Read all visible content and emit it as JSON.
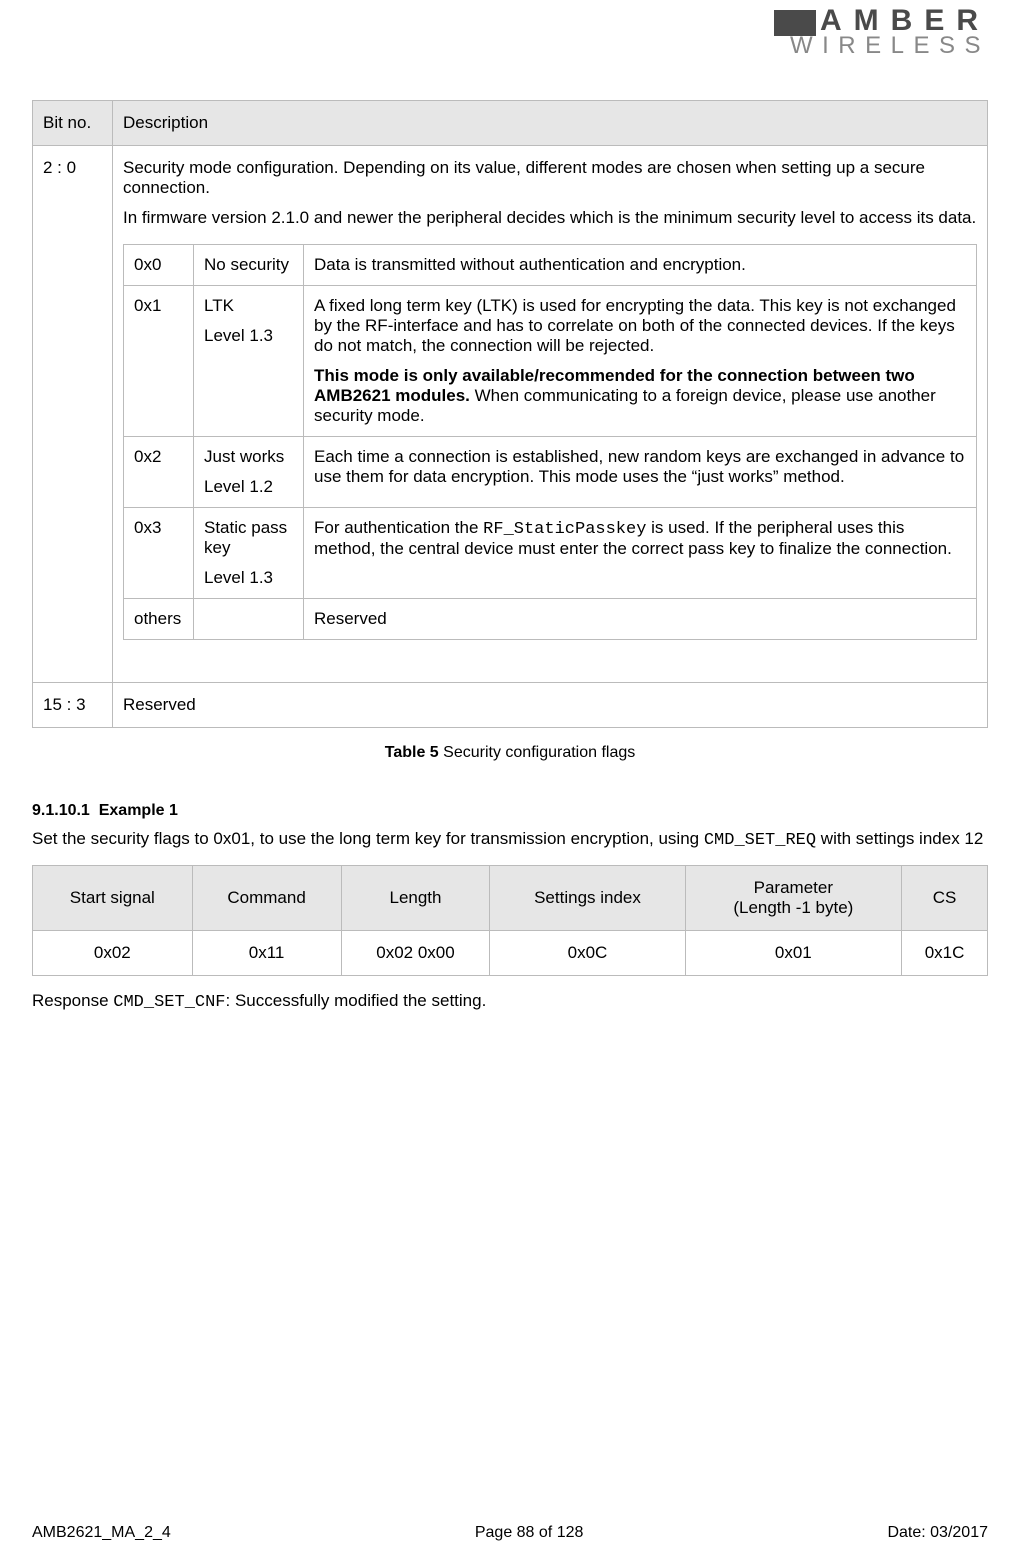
{
  "logo": {
    "top": "AMBER",
    "bottom": "WIRELESS"
  },
  "outerHeaders": {
    "bitno": "Bit no.",
    "description": "Description"
  },
  "row20": {
    "bits": "2 : 0",
    "p1": "Security mode configuration. Depending on its value, different modes are chosen when setting up a secure connection.",
    "p2": "In firmware version 2.1.0 and newer the peripheral decides which is the minimum security level to access its data."
  },
  "inner": [
    {
      "code": "0x0",
      "label_lines": [
        "No security"
      ],
      "desc_parts": [
        {
          "text": "Data is transmitted without authentication and encryption.",
          "bold": false
        }
      ]
    },
    {
      "code": "0x1",
      "label_lines": [
        "LTK",
        "Level 1.3"
      ],
      "desc_parts": [
        {
          "text": "A fixed long term key (LTK) is used for encrypting the data. This key is not exchanged by the RF-interface and has to correlate on both of the connected devices. If the keys do not match, the connection will be rejected.",
          "bold": false
        },
        {
          "text_bold": "This mode is only available/recommended for the connection between two AMB2621 modules. ",
          "text_tail": "When communicating to a foreign device, please use another security mode."
        }
      ]
    },
    {
      "code": "0x2",
      "label_lines": [
        "Just works",
        "Level 1.2"
      ],
      "desc_parts": [
        {
          "text": "Each time a connection is established, new random keys are exchanged in advance to use them for data encryption. This mode uses the “just works” method.",
          "bold": false
        }
      ]
    },
    {
      "code": "0x3",
      "label_lines": [
        "Static pass key",
        "Level 1.3"
      ],
      "desc_parts": [
        {
          "text_pre": "For authentication the ",
          "code": "RF_StaticPasskey",
          "text_post": " is used. If the peripheral uses this method, the central device must enter the correct pass key to finalize the connection."
        }
      ]
    },
    {
      "code": "others",
      "label_lines": [
        ""
      ],
      "desc_parts": [
        {
          "text": "Reserved",
          "bold": false
        }
      ]
    }
  ],
  "row15_3": {
    "bits": "15 : 3",
    "desc": "Reserved"
  },
  "caption": {
    "label": "Table 5",
    "text": " Security configuration flags"
  },
  "example": {
    "heading_num": "9.1.10.1",
    "heading_text": "Example 1",
    "para_pre": "Set the security flags to 0x01, to use the long term key for transmission encryption, using ",
    "para_code": "CMD_SET_REQ",
    "para_post": " with settings index 12"
  },
  "cmdHeaders": [
    "Start signal",
    "Command",
    "Length",
    "Settings index",
    "Parameter\n(Length -1 byte)",
    "CS"
  ],
  "cmdValues": [
    "0x02",
    "0x11",
    "0x02 0x00",
    "0x0C",
    "0x01",
    "0x1C"
  ],
  "response": {
    "pre": "Response ",
    "code": "CMD_SET_CNF",
    "post": ": Successfully modified the setting."
  },
  "footer": {
    "left": "AMB2621_MA_2_4",
    "center": "Page 88 of 128",
    "right": "Date: 03/2017"
  }
}
